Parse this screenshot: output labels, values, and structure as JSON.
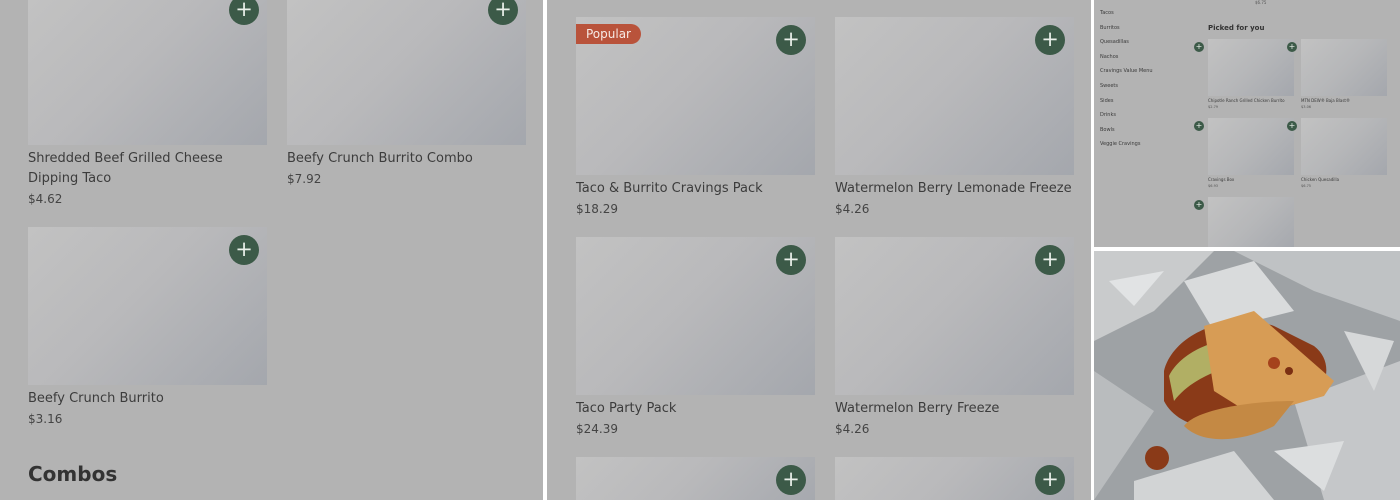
{
  "left_panel": {
    "items": [
      {
        "name": "Shredded Beef Grilled Cheese Dipping Taco",
        "price": "$4.62"
      },
      {
        "name": "Beefy Crunch Burrito Combo",
        "price": "$7.92"
      },
      {
        "name": "Beefy Crunch Burrito",
        "price": "$3.16"
      }
    ],
    "section_heading": "Combos",
    "add_symbol": "+"
  },
  "middle_panel": {
    "items": [
      {
        "name": "Taco & Burrito Cravings Pack",
        "price": "$18.29",
        "badge": "Popular"
      },
      {
        "name": "Watermelon Berry Lemonade Freeze",
        "price": "$4.26"
      },
      {
        "name": "Taco Party Pack",
        "price": "$24.39"
      },
      {
        "name": "Watermelon Berry Freeze",
        "price": "$4.26"
      }
    ],
    "add_symbol": "+"
  },
  "top_right_panel": {
    "categories": [
      "Tacos",
      "Burritos",
      "Quesadillas",
      "Nachos",
      "Cravings Value Menu",
      "Sweets",
      "Sides",
      "Drinks",
      "Bowls",
      "Veggie Cravings"
    ],
    "top_price": "$6.75",
    "section_title": "Picked for you",
    "items": [
      {
        "name": "Chipotle Ranch Grilled Chicken Burrito",
        "price": "$2.79"
      },
      {
        "name": "MTN DEW® Baja Blast®",
        "price": "$3.06"
      },
      {
        "name": "Cravings Box",
        "price": "$6.93"
      },
      {
        "name": "Chicken Quesadilla",
        "price": "$6.75"
      },
      {
        "name": "",
        "price": ""
      }
    ],
    "add_symbol": "+"
  },
  "photo_panel": {
    "subject": "half-eaten taco on foil wrapper",
    "colors": {
      "foil": "#c9cbcc",
      "shell": "#d79c55",
      "filling": "#8a3a18",
      "lettuce": "#b7c472"
    }
  },
  "colors": {
    "overlay_gray": "#b3b3b3",
    "add_button": "#3c5a48",
    "badge": "#b9533b"
  }
}
